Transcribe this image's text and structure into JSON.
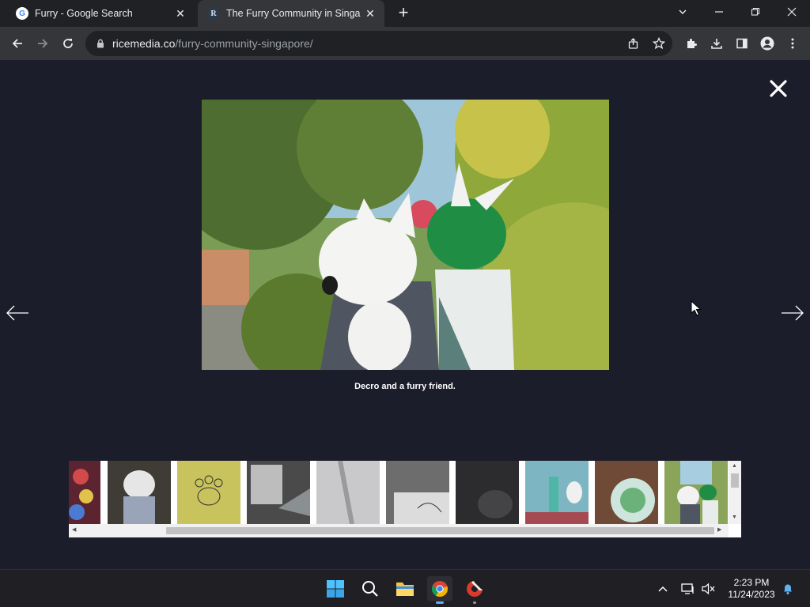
{
  "browser": {
    "tabs": [
      {
        "title": "Furry - Google Search",
        "favicon": "google-favicon",
        "favicon_glyph": "G",
        "active": false
      },
      {
        "title": "The Furry Community in Singapore",
        "favicon": "ricemedia-favicon",
        "favicon_glyph": "R",
        "active": true
      }
    ],
    "address": {
      "host": "ricemedia.co",
      "path": "/furry-community-singapore/"
    }
  },
  "lightbox": {
    "caption": "Decro and a furry friend.",
    "thumbnails": [
      {
        "name": "thumb-costume-crowd"
      },
      {
        "name": "thumb-fursuit-wolf"
      },
      {
        "name": "thumb-paw-sketch"
      },
      {
        "name": "thumb-desk-tablet"
      },
      {
        "name": "thumb-white-fabric"
      },
      {
        "name": "thumb-drawing-paper"
      },
      {
        "name": "thumb-dark-object"
      },
      {
        "name": "thumb-comic-poster"
      },
      {
        "name": "thumb-green-plate"
      },
      {
        "name": "thumb-decro-friend",
        "selected": true
      }
    ]
  },
  "taskbar": {
    "time": "2:23 PM",
    "date": "11/24/2023"
  },
  "colors": {
    "page_bg": "#1c1d2b",
    "chrome_dark": "#202124",
    "toolbar": "#35363a",
    "accent": "#5fb2f2"
  }
}
